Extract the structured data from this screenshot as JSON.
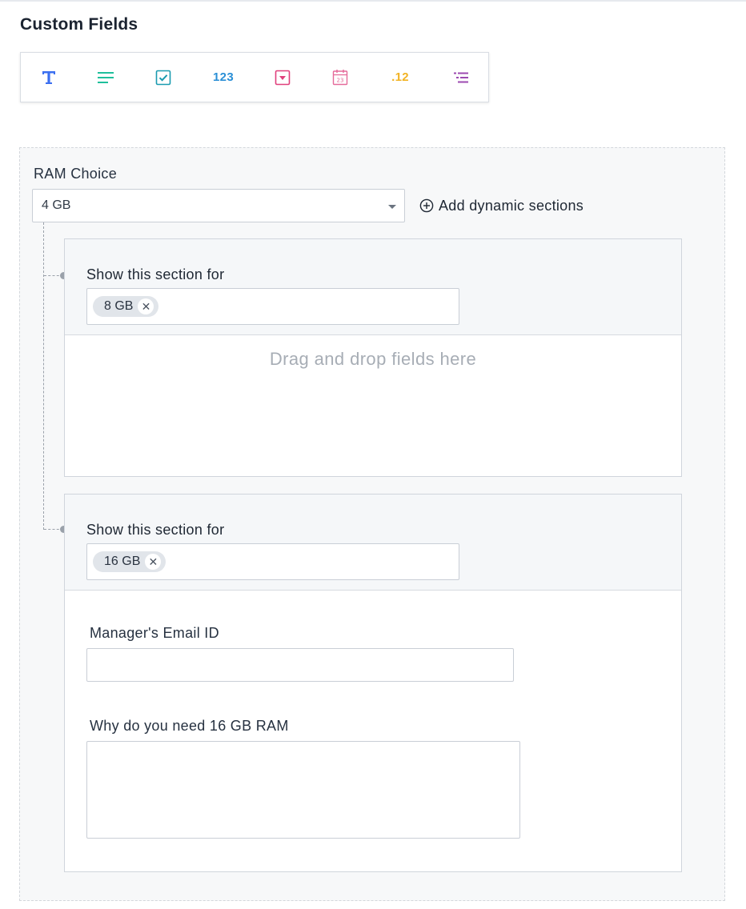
{
  "page": {
    "title": "Custom Fields"
  },
  "palette": {
    "items": [
      {
        "name": "single-line-text",
        "icon": "text-icon",
        "color": "#3b6ff0"
      },
      {
        "name": "paragraph",
        "icon": "paragraph-icon",
        "color": "#1fbf9b"
      },
      {
        "name": "checkbox",
        "icon": "checkbox-icon",
        "color": "#1a9bb0"
      },
      {
        "name": "number",
        "icon": "number-icon",
        "label": "123",
        "color": "#2a8fd6"
      },
      {
        "name": "dropdown",
        "icon": "dropdown-icon",
        "color": "#e0407c"
      },
      {
        "name": "date",
        "icon": "calendar-icon",
        "color": "#e56a9a"
      },
      {
        "name": "decimal",
        "icon": "decimal-icon",
        "label": ".12",
        "color": "#f2b324"
      },
      {
        "name": "dependent-field",
        "icon": "list-icon",
        "color": "#9c4ab0"
      }
    ]
  },
  "ram_field": {
    "label": "RAM Choice",
    "selected_value": "4 GB",
    "add_dynamic_label": "Add dynamic sections"
  },
  "sections": [
    {
      "label": "Show this section for",
      "tag": "8 GB",
      "drop_text": "Drag and drop fields here"
    },
    {
      "label": "Show this section for",
      "tag": "16 GB",
      "fields": {
        "email_label": "Manager's Email ID",
        "email_value": "",
        "reason_label": "Why do you need 16 GB RAM",
        "reason_value": ""
      }
    }
  ]
}
